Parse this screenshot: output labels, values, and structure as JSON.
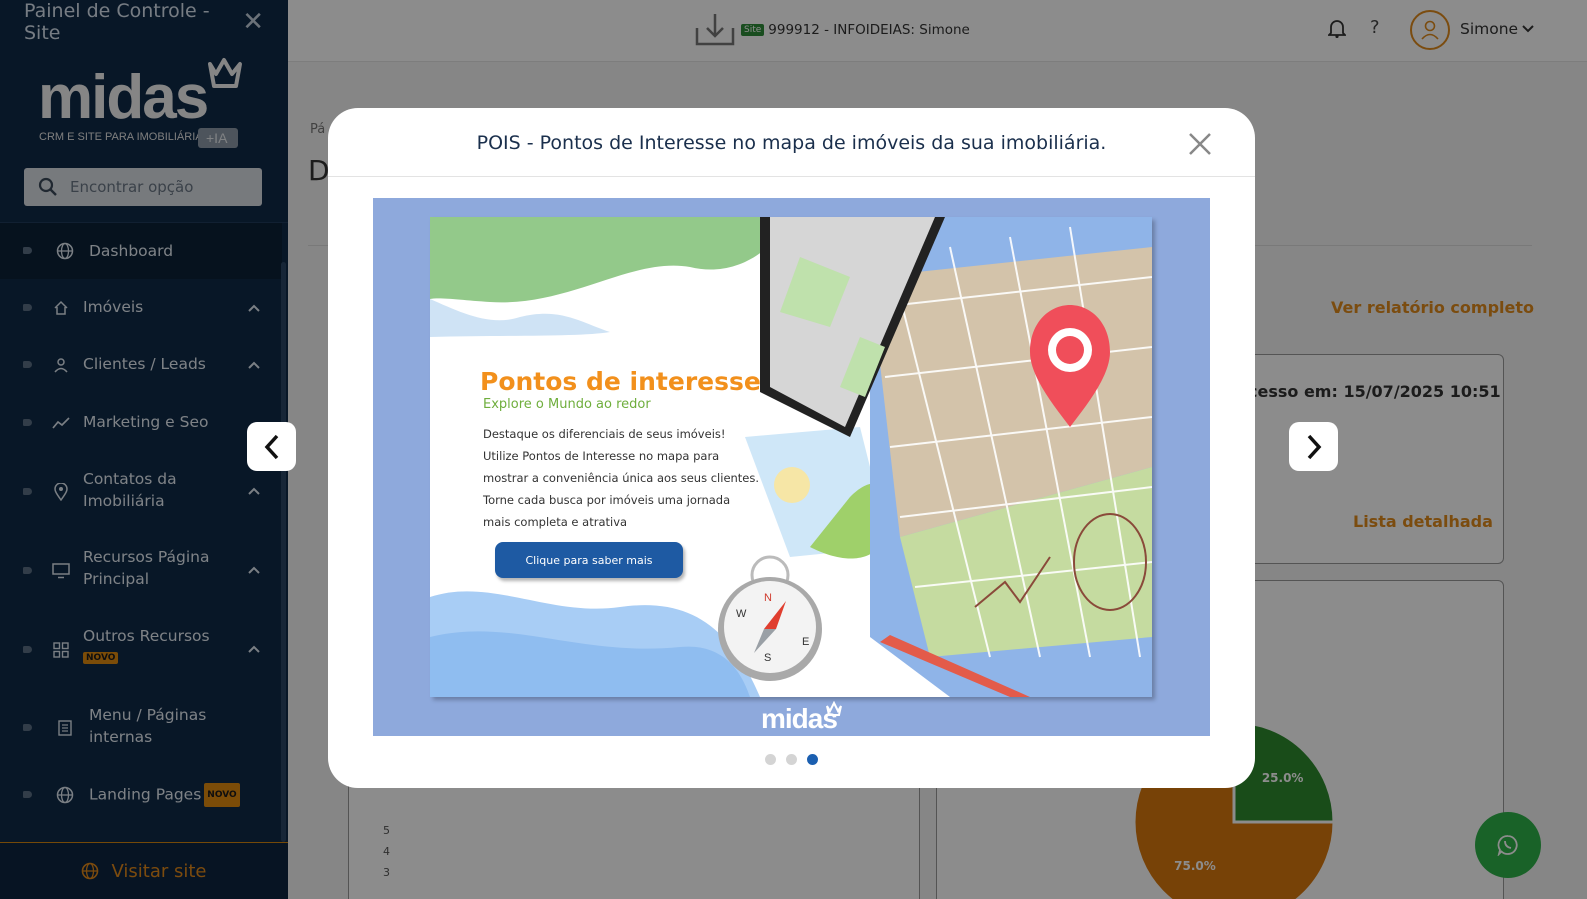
{
  "sidebar": {
    "title": "Painel de Controle - Site",
    "logo": {
      "brand": "midas",
      "tagline": "CRM E SITE PARA IMOBILIÁRIA",
      "badge": "+IA"
    },
    "search_placeholder": "Encontrar opção",
    "items": [
      {
        "label": "Dashboard",
        "icon": "globe-icon"
      },
      {
        "label": "Imóveis",
        "icon": "home-icon"
      },
      {
        "label": "Clientes / Leads",
        "icon": "user-icon"
      },
      {
        "label": "Marketing e Seo",
        "icon": "trend-icon"
      },
      {
        "label": "Contatos da Imobiliária",
        "icon": "location-pin-icon"
      },
      {
        "label": "Recursos Página Principal",
        "icon": "monitor-icon"
      },
      {
        "label": "Outros Recursos",
        "icon": "grid-icon",
        "badge": "NOVO"
      },
      {
        "label": "Menu / Páginas internas",
        "icon": "page-icon"
      },
      {
        "label": "Landing Pages",
        "icon": "globe-icon",
        "badge": "NOVO"
      }
    ],
    "visit_label": "Visitar site"
  },
  "topbar": {
    "site_tag": "Site",
    "site_info": "999912 - INFOIDEIAS: Simone",
    "help": "?",
    "username": "Simone"
  },
  "background": {
    "breadcrumb": "Pá",
    "heading": "D",
    "report_link": "Ver relatório completo",
    "last_access": "cesso em: 15/07/2025 10:51",
    "detail_link": "Lista detalhada",
    "ticks": [
      "5",
      "4",
      "3"
    ],
    "pie": {
      "slices": [
        {
          "label": "25.0%",
          "value": 25,
          "color": "#2e8b2e"
        },
        {
          "label": "75.0%",
          "value": 75,
          "color": "#d9780e"
        }
      ]
    }
  },
  "modal": {
    "title": "POIS - Pontos de Interesse no mapa de imóveis da sua imobiliária.",
    "slide": {
      "heading": "Pontos de interesse",
      "subheading": "Explore o Mundo ao redor",
      "body": [
        "Destaque os diferenciais de seus imóveis!",
        "Utilize Pontos de Interesse no mapa para",
        "mostrar a conveniência única aos seus clientes.",
        "Torne cada busca por imóveis uma jornada",
        "mais completa e atrativa"
      ],
      "button": "Clique para saber mais",
      "logo": "midas"
    },
    "active_slide": 3,
    "slide_count": 3
  },
  "colors": {
    "sidebar_bg": "#0f2a47",
    "accent": "#e08a1c",
    "primary_blue": "#1e5aa3"
  }
}
